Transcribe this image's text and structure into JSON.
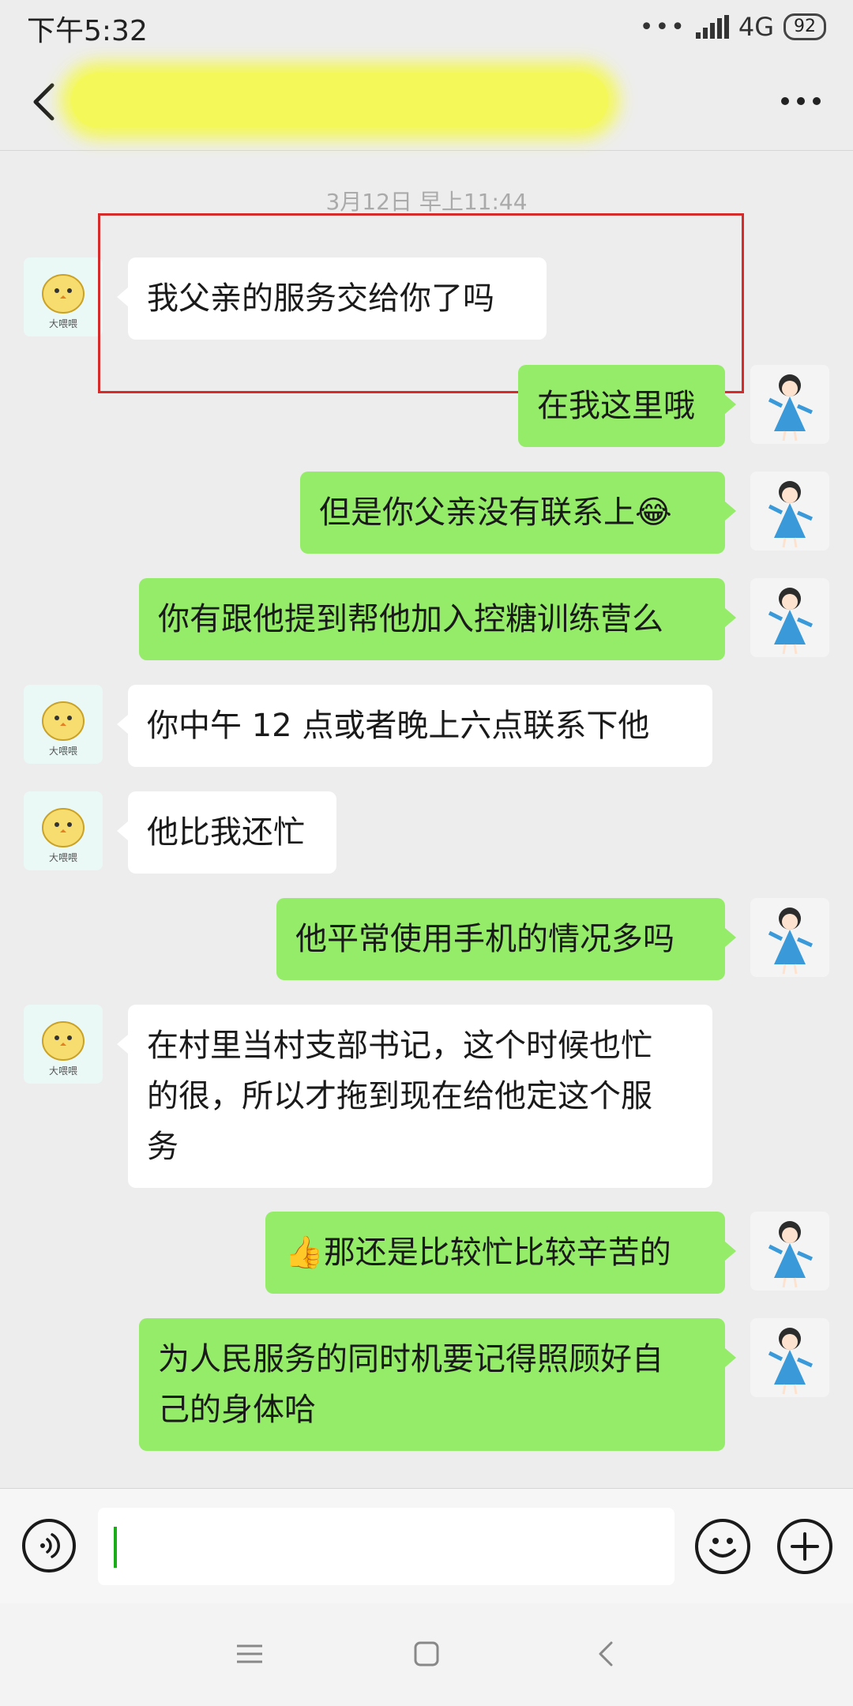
{
  "status_bar": {
    "time": "下午5:32",
    "network": "4G",
    "battery": "92"
  },
  "chat": {
    "timestamp": "3月12日 早上11:44"
  },
  "messages": [
    {
      "side": "left",
      "text": "我父亲的服务交给你了吗"
    },
    {
      "side": "right",
      "text": "在我这里哦"
    },
    {
      "side": "right",
      "text": "但是你父亲没有联系上",
      "emoji": "😂"
    },
    {
      "side": "right",
      "text": "你有跟他提到帮他加入控糖训练营么"
    },
    {
      "side": "left",
      "text": "你中午 12 点或者晚上六点联系下他"
    },
    {
      "side": "left",
      "text": "他比我还忙"
    },
    {
      "side": "right",
      "text": "他平常使用手机的情况多吗"
    },
    {
      "side": "left",
      "lines": [
        "在村里当村支部书记，这个时候也忙",
        "的很，所以才拖到现在给他定这个服",
        "务"
      ]
    },
    {
      "side": "right",
      "emoji": "👍",
      "text": "那还是比较忙比较辛苦的"
    },
    {
      "side": "right",
      "lines": [
        "为人民服务的同时机要记得照顾好自",
        "己的身体哈"
      ]
    }
  ],
  "avatars": {
    "left_caption": "大喂喂"
  },
  "icons": {
    "back": "back-arrow-icon",
    "more": "more-dots-icon",
    "voice": "voice-icon",
    "emoji": "smiley-icon",
    "plus": "plus-icon",
    "menu": "menu-icon",
    "home": "home-icon",
    "nav_back": "nav-back-icon"
  },
  "colors": {
    "self_bubble": "#95ec69",
    "other_bubble": "#ffffff",
    "background": "#ededed",
    "highlight": "#d52b2b",
    "caret": "#1aad19"
  }
}
